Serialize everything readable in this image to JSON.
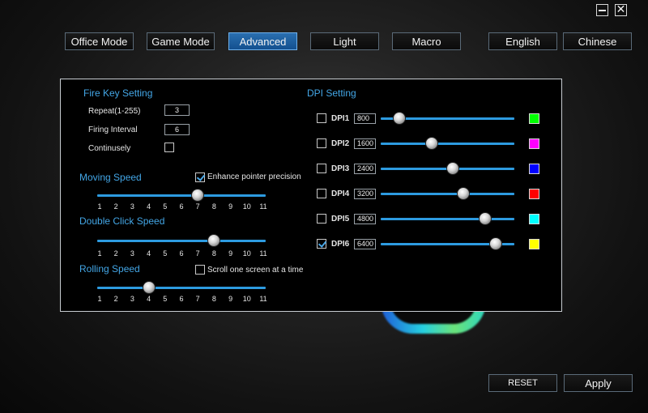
{
  "window": {
    "minimize_label": "",
    "close_label": "✕"
  },
  "tabs": [
    {
      "label": "Office Mode",
      "active": false
    },
    {
      "label": "Game Mode",
      "active": false
    },
    {
      "label": "Advanced",
      "active": true
    },
    {
      "label": "Light",
      "active": false
    },
    {
      "label": "Macro",
      "active": false
    }
  ],
  "languages": [
    {
      "label": "English"
    },
    {
      "label": "Chinese"
    }
  ],
  "fire_key": {
    "title": "Fire Key Setting",
    "repeat_label": "Repeat(1-255)",
    "repeat_value": "3",
    "interval_label": "Firing Interval",
    "interval_value": "6",
    "continuous_label": "Continusely",
    "continuous_checked": false
  },
  "moving_speed": {
    "title": "Moving Speed",
    "enhance_label": "Enhance pointer precision",
    "enhance_checked": true,
    "value": 7
  },
  "double_click_speed": {
    "title": "Double Click Speed",
    "value": 8
  },
  "rolling_speed": {
    "title": "Rolling Speed",
    "scroll_label": "Scroll one screen at a time",
    "scroll_checked": false,
    "value": 4
  },
  "scale_ticks": [
    "1",
    "2",
    "3",
    "4",
    "5",
    "6",
    "7",
    "8",
    "9",
    "10",
    "11"
  ],
  "dpi": {
    "title": "DPI Setting",
    "levels": [
      {
        "label": "DPI1",
        "value": "800",
        "checked": false,
        "slider": 0.14,
        "color": "#00ff00"
      },
      {
        "label": "DPI2",
        "value": "1600",
        "checked": false,
        "slider": 0.38,
        "color": "#ff00ff"
      },
      {
        "label": "DPI3",
        "value": "2400",
        "checked": false,
        "slider": 0.54,
        "color": "#0000ff"
      },
      {
        "label": "DPI4",
        "value": "3200",
        "checked": false,
        "slider": 0.62,
        "color": "#ff0000"
      },
      {
        "label": "DPI5",
        "value": "4800",
        "checked": false,
        "slider": 0.78,
        "color": "#00ffff"
      },
      {
        "label": "DPI6",
        "value": "6400",
        "checked": true,
        "slider": 0.86,
        "color": "#ffff00"
      }
    ]
  },
  "footer": {
    "reset_label": "RESET",
    "apply_label": "Apply"
  }
}
